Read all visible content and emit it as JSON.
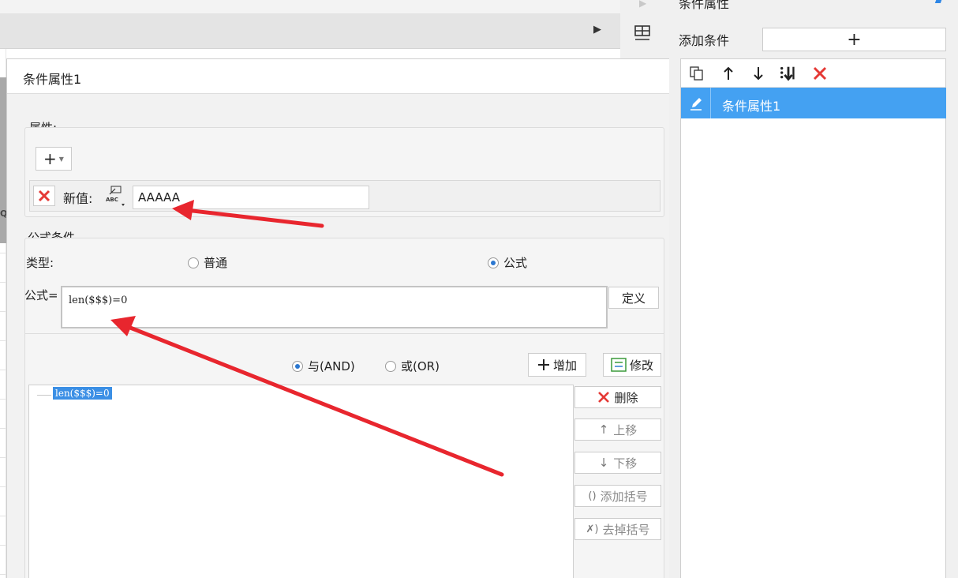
{
  "dialog": {
    "title": "条件属性1"
  },
  "attributes": {
    "section_label": "属性:",
    "add_button": "+",
    "new_value_label": "新值:",
    "new_value": "AAAAA",
    "type_icon_text": "ABC"
  },
  "formula_condition": {
    "section_label": "公式条件",
    "type_label": "类型:",
    "type_options": [
      {
        "label": "普通",
        "checked": false
      },
      {
        "label": "公式",
        "checked": true
      }
    ],
    "formula_label": "公式=",
    "formula_value": "len($$$)=0",
    "define_button": "定义",
    "logic_options": [
      {
        "label": "与(AND)",
        "checked": true
      },
      {
        "label": "或(OR)",
        "checked": false
      }
    ],
    "add_button": "增加",
    "modify_button": "修改",
    "tree_items": [
      "len($$$)=0"
    ],
    "side_buttons": {
      "delete": "删除",
      "move_up": "上移",
      "move_down": "下移",
      "add_brackets": "添加括号",
      "remove_brackets": "去掉括号"
    }
  },
  "right_panel": {
    "title": "条件属性",
    "add_condition_label": "添加条件",
    "add_button": "+",
    "list_items": [
      {
        "label": "条件属性1"
      }
    ]
  },
  "colors": {
    "accent": "#44a1f2",
    "annotation_arrow": "#e8262e",
    "delete_red": "#e53935",
    "radio_blue": "#2b77d0"
  }
}
